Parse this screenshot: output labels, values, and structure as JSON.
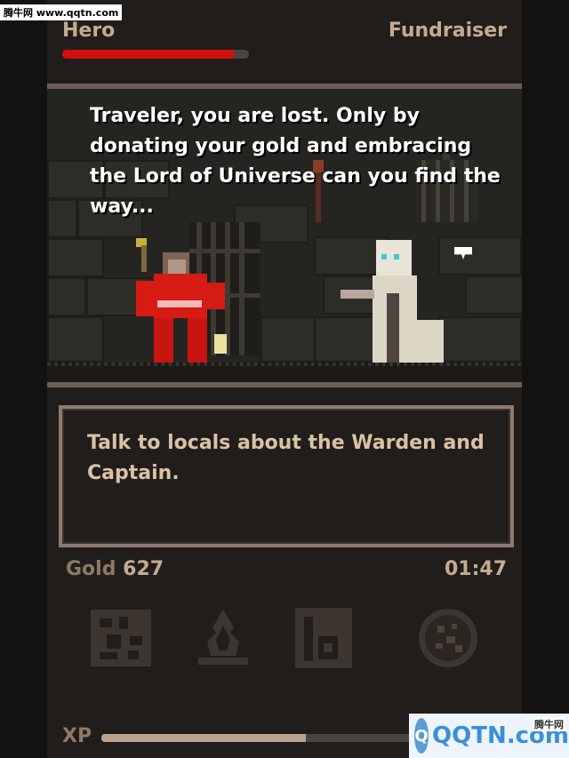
{
  "header": {
    "hero_label": "Hero",
    "fundraiser_label": "Fundraiser",
    "hero_health_fraction": 0.92
  },
  "scene": {
    "dialogue": "Traveler, you are lost. Only by donating your gold and embracing the Lord of Universe can you find the way..."
  },
  "quest": {
    "text": "Talk to locals about the Warden and Captain."
  },
  "status": {
    "gold_label": "Gold",
    "gold_value": "627",
    "timer": "01:47"
  },
  "actions": [
    {
      "icon": "map-icon"
    },
    {
      "icon": "campfire-icon"
    },
    {
      "icon": "journal-icon"
    },
    {
      "icon": "cookie-icon"
    }
  ],
  "xp": {
    "label": "XP",
    "fraction": 0.64
  },
  "watermarks": {
    "top": "腾牛网 www.qqtn.com",
    "brand": "QQTN.com",
    "brand_sub": "腾牛网"
  },
  "colors": {
    "health": "#d10f0f",
    "text_light": "#c2ac91",
    "quest_text": "#d8c3a6",
    "panel": "#211d1a"
  }
}
